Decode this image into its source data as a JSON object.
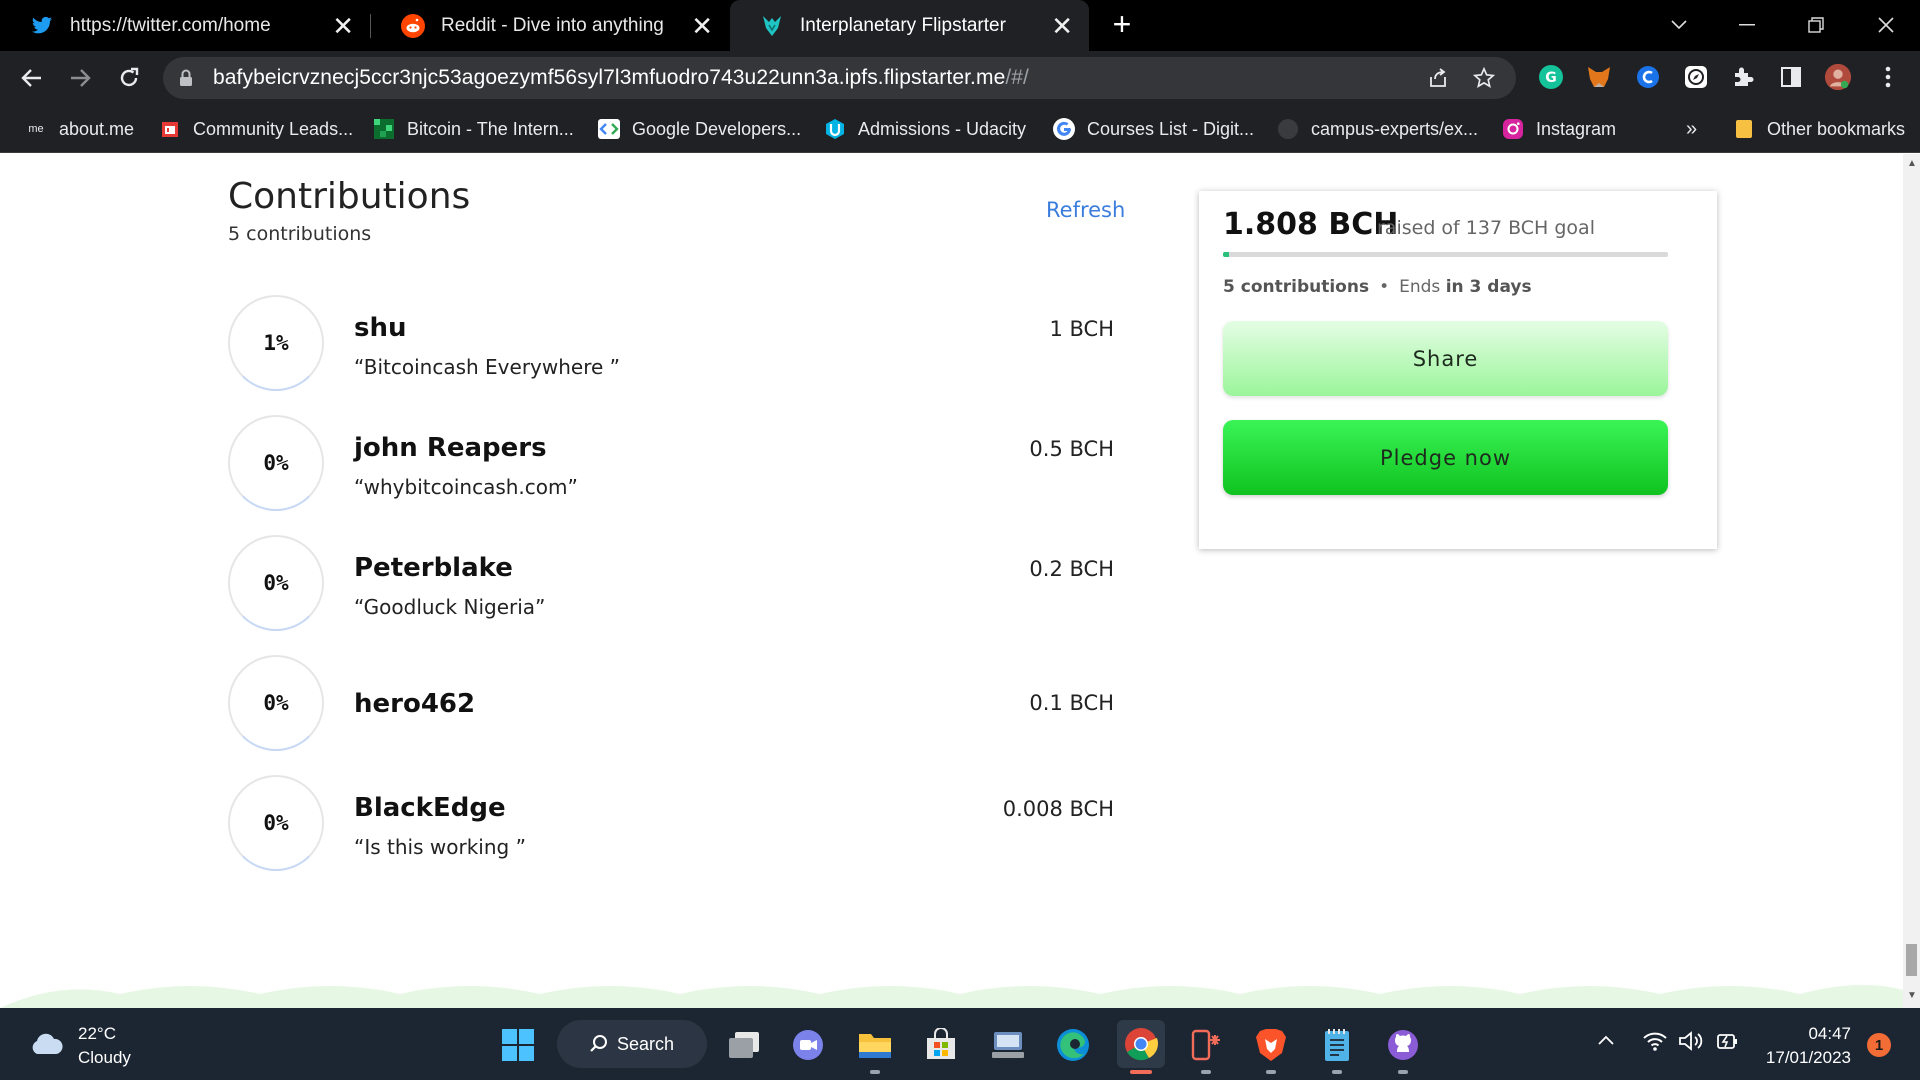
{
  "browser": {
    "tabs": [
      {
        "title": "https://twitter.com/home",
        "icon": "twitter-icon"
      },
      {
        "title": "Reddit - Dive into anything",
        "icon": "reddit-icon"
      },
      {
        "title": "Interplanetary Flipstarter",
        "icon": "flipstarter-icon",
        "active": true
      }
    ],
    "url_main": "bafybeicrvznecj5ccr3njc53agoezymf56syl7l3mfuodro743u22unn3a.ipfs.flipstarter.me",
    "url_rest": "/#/",
    "bookmarks": [
      {
        "label": "about.me",
        "icon_text": "me"
      },
      {
        "label": "Community Leads..."
      },
      {
        "label": "Bitcoin - The Intern..."
      },
      {
        "label": "Google Developers..."
      },
      {
        "label": "Admissions - Udacity"
      },
      {
        "label": "Courses List - Digit..."
      },
      {
        "label": "campus-experts/ex..."
      },
      {
        "label": "Instagram"
      }
    ],
    "more_bookmarks": "»",
    "other_bookmarks": "Other bookmarks"
  },
  "page": {
    "contributions_title": "Contributions",
    "contributions_count": "5 contributions",
    "refresh_label": "Refresh",
    "contributions": [
      {
        "percent": "1%",
        "name": "shu",
        "message": "“Bitcoincash Everywhere ”",
        "amount": "1 BCH"
      },
      {
        "percent": "0%",
        "name": "john Reapers",
        "message": "“whybitcoincash.com”",
        "amount": "0.5 BCH"
      },
      {
        "percent": "0%",
        "name": "Peterblake",
        "message": "“Goodluck Nigeria”",
        "amount": "0.2 BCH"
      },
      {
        "percent": "0%",
        "name": "hero462",
        "message": "",
        "amount": "0.1 BCH"
      },
      {
        "percent": "0%",
        "name": "BlackEdge",
        "message": "“Is this working ”",
        "amount": "0.008 BCH"
      }
    ],
    "card": {
      "raised": "1.808 BCH",
      "goal_text": "raised of 137 BCH goal",
      "progress_fraction": 0.013,
      "stats_count": "5 contributions",
      "stats_separator": "•",
      "stats_ends_prefix": "Ends",
      "stats_ends_value": "in 3 days",
      "share_label": "Share",
      "pledge_label": "Pledge now"
    }
  },
  "taskbar": {
    "temperature": "22°C",
    "condition": "Cloudy",
    "search_label": "Search",
    "time": "04:47",
    "date": "17/01/2023",
    "notification_count": "1"
  },
  "colors": {
    "accent_link": "#3b7ddd",
    "progress": "#2ac07a",
    "pledge_green": "#1ed83a",
    "share_green": "#b8f7b8"
  }
}
